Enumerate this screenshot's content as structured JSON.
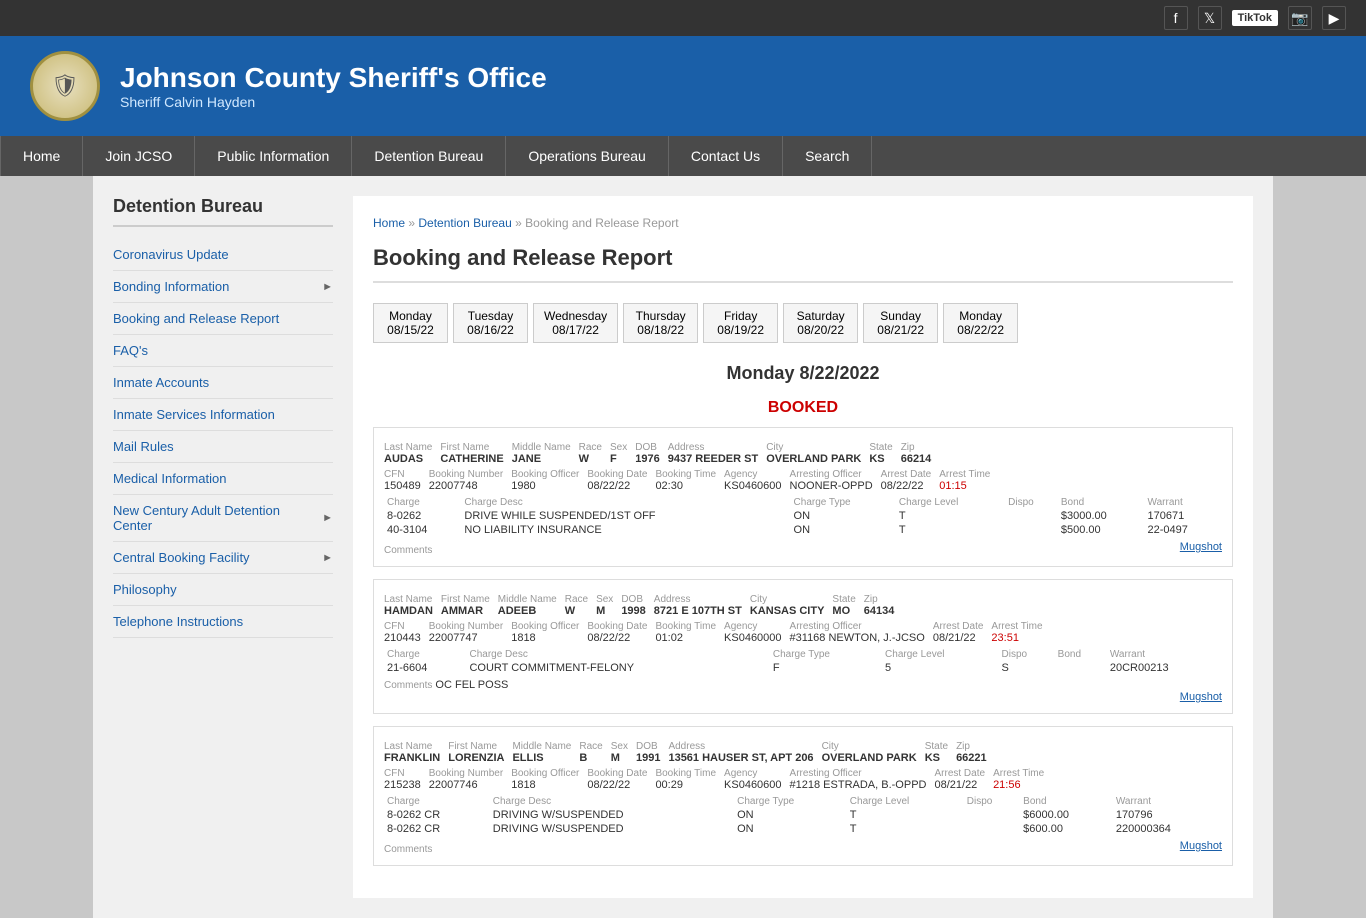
{
  "topbar": {
    "social": [
      "f",
      "t",
      "TikTok",
      "📷",
      "▶"
    ]
  },
  "header": {
    "title": "Johnson County Sheriff's Office",
    "subtitle": "Sheriff Calvin Hayden",
    "badge_icon": "🛡"
  },
  "nav": {
    "items": [
      "Home",
      "Join JCSO",
      "Public Information",
      "Detention Bureau",
      "Operations Bureau",
      "Contact Us",
      "Search"
    ]
  },
  "sidebar": {
    "heading": "Detention Bureau",
    "links": [
      {
        "label": "Coronavirus Update",
        "arrow": false
      },
      {
        "label": "Bonding Information",
        "arrow": true
      },
      {
        "label": "Booking and Release Report",
        "arrow": false
      },
      {
        "label": "FAQ's",
        "arrow": false
      },
      {
        "label": "Inmate Accounts",
        "arrow": false
      },
      {
        "label": "Inmate Services Information",
        "arrow": false
      },
      {
        "label": "Mail Rules",
        "arrow": false
      },
      {
        "label": "Medical Information",
        "arrow": false
      },
      {
        "label": "New Century Adult Detention Center",
        "arrow": true
      },
      {
        "label": "Central Booking Facility",
        "arrow": true
      },
      {
        "label": "Philosophy",
        "arrow": false
      },
      {
        "label": "Telephone Instructions",
        "arrow": false
      }
    ]
  },
  "breadcrumb": {
    "items": [
      "Home",
      "Detention Bureau",
      "Booking and Release Report"
    ],
    "separators": [
      "»",
      "»"
    ]
  },
  "page_title": "Booking and Release Report",
  "date_nav": [
    {
      "label": "Monday",
      "date": "08/15/22"
    },
    {
      "label": "Tuesday",
      "date": "08/16/22"
    },
    {
      "label": "Wednesday",
      "date": "08/17/22"
    },
    {
      "label": "Thursday",
      "date": "08/18/22"
    },
    {
      "label": "Friday",
      "date": "08/19/22"
    },
    {
      "label": "Saturday",
      "date": "08/20/22"
    },
    {
      "label": "Sunday",
      "date": "08/21/22"
    },
    {
      "label": "Monday",
      "date": "08/22/22"
    }
  ],
  "report_date": "Monday 8/22/2022",
  "booked_header": "BOOKED",
  "inmates": [
    {
      "last": "AUDAS",
      "first": "CATHERINE",
      "middle": "JANE",
      "race": "W",
      "sex": "F",
      "dob": "1976",
      "address": "9437 REEDER ST",
      "city": "OVERLAND PARK",
      "state": "KS",
      "zip": "66214",
      "cfn": "150489",
      "booking_number": "22007748",
      "booking_officer": "1980",
      "booking_date": "08/22/22",
      "booking_time": "02:30",
      "agency": "KS0460600",
      "arresting_officer": "NOONER-OPPD",
      "arrest_date": "08/22/22",
      "arrest_time": "01:15",
      "charges": [
        {
          "charge": "8-0262",
          "desc": "DRIVE WHILE SUSPENDED/1ST OFF",
          "type": "",
          "level": "T",
          "dispo": "",
          "bond": "$3000.00",
          "warrant": "170671"
        },
        {
          "charge": "40-3104",
          "desc": "NO LIABILITY INSURANCE",
          "type": "",
          "level": "T",
          "dispo": "",
          "bond": "$500.00",
          "warrant": "22-0497"
        }
      ],
      "mugshot": true
    },
    {
      "last": "HAMDAN",
      "first": "AMMAR",
      "middle": "ADEEB",
      "race": "W",
      "sex": "M",
      "dob": "1998",
      "address": "8721 E 107TH ST",
      "city": "KANSAS CITY",
      "state": "MO",
      "zip": "64134",
      "cfn": "210443",
      "booking_number": "22007747",
      "booking_officer": "1818",
      "booking_date": "08/22/22",
      "booking_time": "01:02",
      "agency": "KS0460000",
      "arresting_officer": "#31168 NEWTON, J.-JCSO",
      "arrest_date": "08/21/22",
      "arrest_time": "23:51",
      "charges": [
        {
          "charge": "21-6604",
          "desc": "COURT COMMITMENT-FELONY",
          "type": "F",
          "level": "5",
          "dispo": "S",
          "bond": "",
          "warrant": "20CR00213"
        }
      ],
      "comments": "OC FEL POSS",
      "mugshot": true
    },
    {
      "last": "FRANKLIN",
      "first": "LORENZIA",
      "middle": "ELLIS",
      "race": "B",
      "sex": "M",
      "dob": "1991",
      "address": "13561 HAUSER ST, APT 206",
      "city": "OVERLAND PARK",
      "state": "KS",
      "zip": "66221",
      "cfn": "215238",
      "booking_number": "22007746",
      "booking_officer": "1818",
      "booking_date": "08/22/22",
      "booking_time": "00:29",
      "agency": "KS0460600",
      "arresting_officer": "#1218 ESTRADA, B.-OPPD",
      "arrest_date": "08/21/22",
      "arrest_time": "21:56",
      "charges": [
        {
          "charge": "8-0262 CR",
          "desc": "DRIVING W/SUSPENDED",
          "type": "",
          "level": "T",
          "dispo": "",
          "bond": "$6000.00",
          "warrant": "170796"
        },
        {
          "charge": "8-0262 CR",
          "desc": "DRIVING W/SUSPENDED",
          "type": "",
          "level": "T",
          "dispo": "",
          "bond": "$600.00",
          "warrant": "220000364"
        }
      ],
      "mugshot": true
    }
  ],
  "labels": {
    "last_name": "Last Name",
    "first_name": "First Name",
    "middle_name": "Middle Name",
    "race": "Race",
    "sex": "Sex",
    "dob": "DOB",
    "address": "Address",
    "city": "City",
    "state": "State",
    "zip": "Zip",
    "cfn": "CFN",
    "booking_number": "Booking Number",
    "booking_officer": "Booking Officer",
    "booking_date": "Booking Date",
    "booking_time": "Booking Time",
    "agency": "Agency",
    "arresting_officer": "Arresting Officer",
    "arrest_date": "Arrest Date",
    "arrest_time": "Arrest Time",
    "charge": "Charge",
    "charge_desc": "Charge Desc",
    "charge_type": "Charge Type",
    "charge_level": "Charge Level",
    "dispo": "Dispo",
    "bond": "Bond",
    "warrant": "Warrant",
    "comments": "Comments",
    "mugshot": "Mugshot"
  }
}
